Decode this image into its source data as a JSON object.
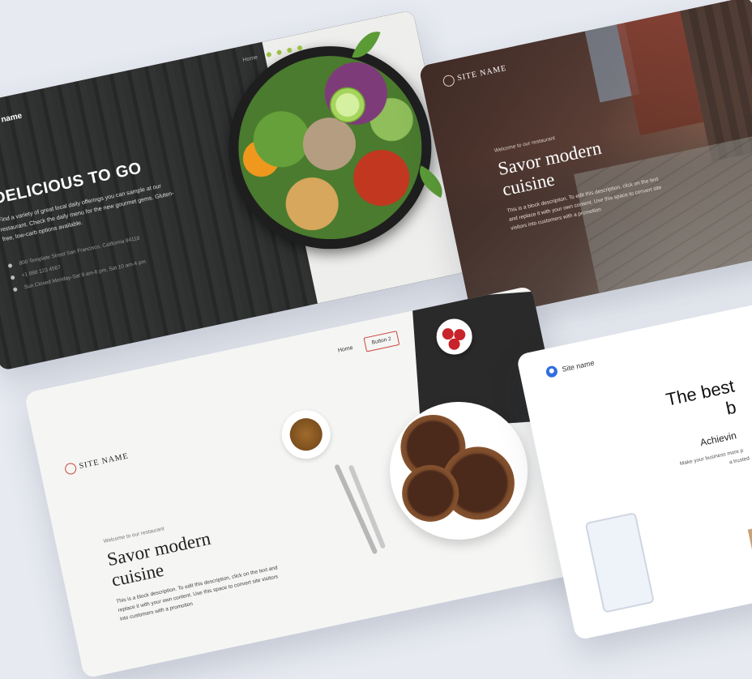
{
  "card_dark": {
    "site_name": "Site name",
    "nav_home": "Home",
    "social_icons": [
      "facebook-icon",
      "instagram-icon",
      "linkedin-icon",
      "twitter-icon"
    ],
    "headline": "DELICIOUS TO GO",
    "description": "Find a variety of great local daily offerings you can sample at our restaurant. Check the daily menu for the new gourmet gems. Gluten-free, low-carb options available.",
    "address": "800 Template Street San Francisco, California 94118",
    "phone": "+1 888 123 4567",
    "hours": "Sun Closed Monday-Sat 9 am-6 pm, Sat 10 am-4 pm",
    "accent": "#9bc044"
  },
  "card_street": {
    "site_name": "SITE NAME",
    "welcome": "Welcome to our restaurant",
    "headline": "Savor modern cuisine",
    "description": "This is a block description. To edit this description, click on the text and replace it with your own content. Use this space to convert site visitors into customers with a promotion"
  },
  "card_light": {
    "nav_home": "Home",
    "button_label": "Button 2",
    "site_name": "SITE NAME",
    "welcome": "Welcome to our restaurant",
    "headline": "Savor modern cuisine",
    "description": "This is a block description. To edit this description, click on the text and replace it with your own content. Use this space to convert site visitors into customers with a promotion",
    "accent": "#c9473c"
  },
  "card_business": {
    "site_name": "Site name",
    "headline_line1": "The best",
    "headline_line2": "b",
    "subheadline": "Achievin",
    "description_line1": "Make your business more p",
    "description_line2": "a trusted",
    "accent": "#2f6de1"
  }
}
